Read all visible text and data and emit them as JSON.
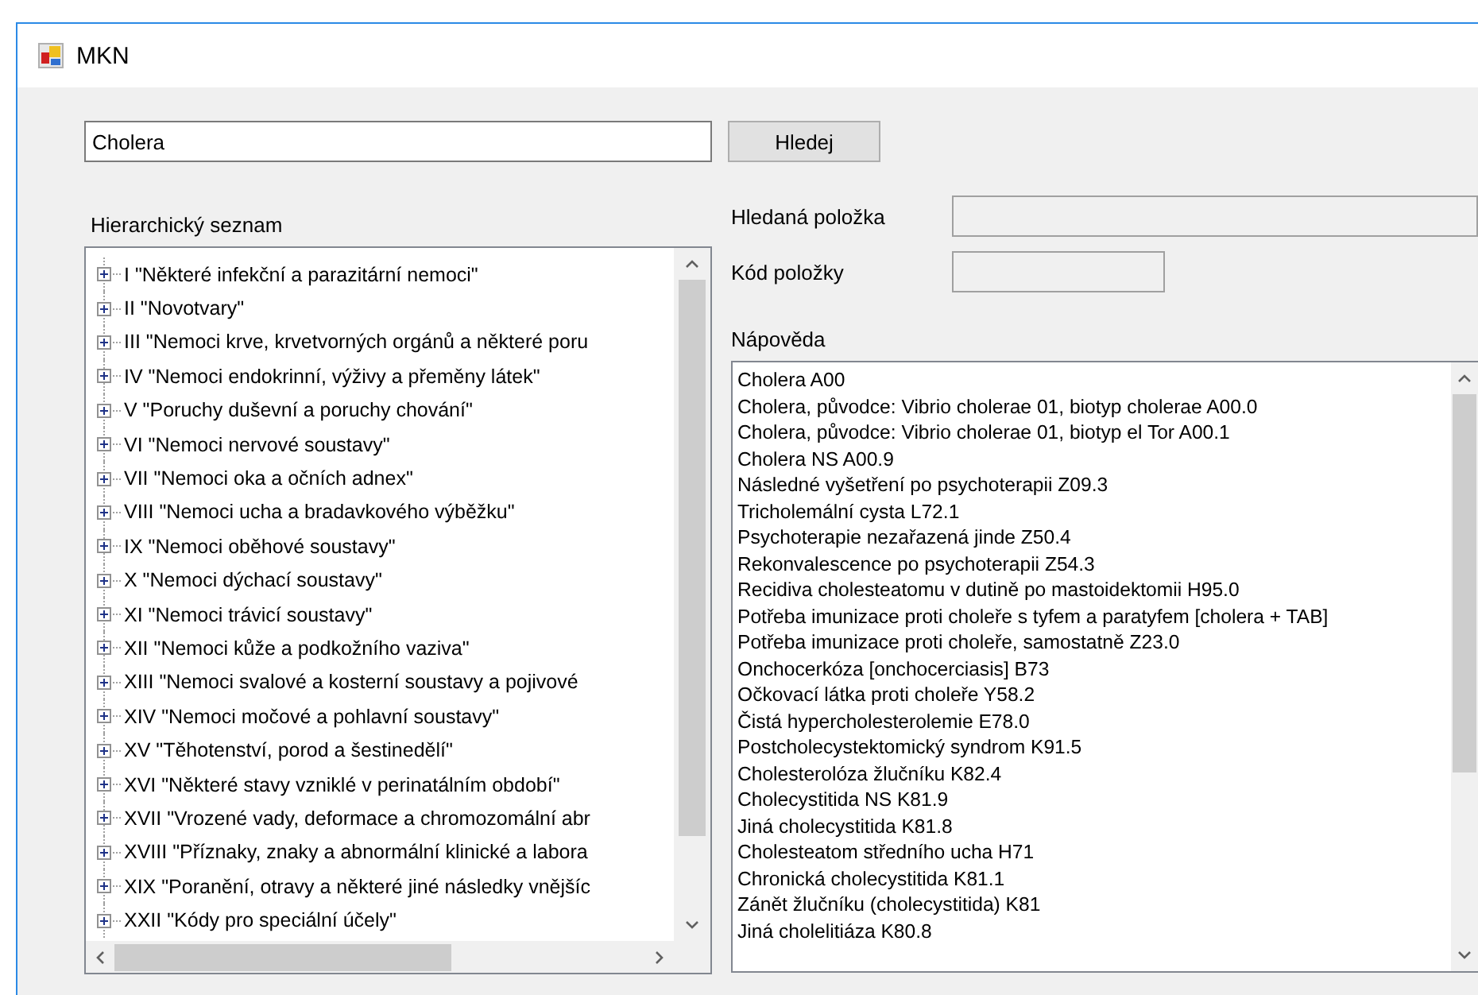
{
  "window": {
    "title": "MKN"
  },
  "search": {
    "value": "Cholera",
    "button": "Hledej"
  },
  "tree": {
    "label": "Hierarchický seznam",
    "items": [
      {
        "label": "I \"Některé infekční a parazitární nemoci\"",
        "expanded": false
      },
      {
        "label": "II \"Novotvary\"",
        "expanded": false
      },
      {
        "label": "III \"Nemoci krve, krvetvorných orgánů a některé poru",
        "expanded": false
      },
      {
        "label": "IV \"Nemoci endokrinní, výživy a přeměny látek\"",
        "expanded": false
      },
      {
        "label": "V \"Poruchy duševní a poruchy chování\"",
        "expanded": false
      },
      {
        "label": "VI \"Nemoci nervové soustavy\"",
        "expanded": false
      },
      {
        "label": "VII \"Nemoci oka a očních adnex\"",
        "expanded": false
      },
      {
        "label": "VIII \"Nemoci ucha a bradavkového výběžku\"",
        "expanded": false
      },
      {
        "label": "IX \"Nemoci oběhové soustavy\"",
        "expanded": false
      },
      {
        "label": "X \"Nemoci dýchací soustavy\"",
        "expanded": false
      },
      {
        "label": "XI \"Nemoci trávicí soustavy\"",
        "expanded": false
      },
      {
        "label": "XII \"Nemoci kůže a podkožního vaziva\"",
        "expanded": false
      },
      {
        "label": "XIII \"Nemoci svalové a kosterní soustavy a pojivové",
        "expanded": false
      },
      {
        "label": "XIV \"Nemoci močové a pohlavní soustavy\"",
        "expanded": false
      },
      {
        "label": "XV \"Těhotenství, porod a šestinedělí\"",
        "expanded": false
      },
      {
        "label": "XVI \"Některé stavy vzniklé v perinatálním období\"",
        "expanded": false
      },
      {
        "label": "XVII \"Vrozené vady, deformace a chromozomální abr",
        "expanded": false
      },
      {
        "label": "XVIII \"Příznaky, znaky a abnormální klinické a labora",
        "expanded": false
      },
      {
        "label": "XIX \"Poranění, otravy a některé jiné následky vnějšíc",
        "expanded": false
      },
      {
        "label": "XXII \"Kódy pro speciální účely\"",
        "expanded": false
      }
    ]
  },
  "fields": [
    {
      "label": "Hledaná položka"
    },
    {
      "label": "Kód položky"
    }
  ],
  "help": {
    "label": "Nápověda",
    "items": [
      "Cholera A00",
      "Cholera, původce: Vibrio cholerae 01, biotyp cholerae A00.0",
      "Cholera, původce: Vibrio cholerae 01, biotyp el Tor A00.1",
      "Cholera NS A00.9",
      "Následné vyšetření po psychoterapii Z09.3",
      "Tricholemální cysta L72.1",
      "Psychoterapie nezařazená jinde Z50.4",
      "Rekonvalescence po psychoterapii Z54.3",
      "Recidiva cholesteatomu v dutině po mastoidektomii H95.0",
      "Potřeba imunizace proti choleře s tyfem a paratyfem [cholera + TAB]",
      "Potřeba imunizace proti choleře, samostatně Z23.0",
      "Onchocerkóza [onchocerciasis] B73",
      "Očkovací látka proti choleře Y58.2",
      "Čistá hypercholesterolemie E78.0",
      "Postcholecystektomický syndrom K91.5",
      "Cholesterolóza žlučníku K82.4",
      "Cholecystitida NS K81.9",
      "Jiná cholecystitida K81.8",
      "Cholesteatom středního ucha H71",
      "Chronická cholecystitida K81.1",
      "Zánět žlučníku (cholecystitida) K81",
      "Jiná cholelitiáza K80.8"
    ]
  }
}
